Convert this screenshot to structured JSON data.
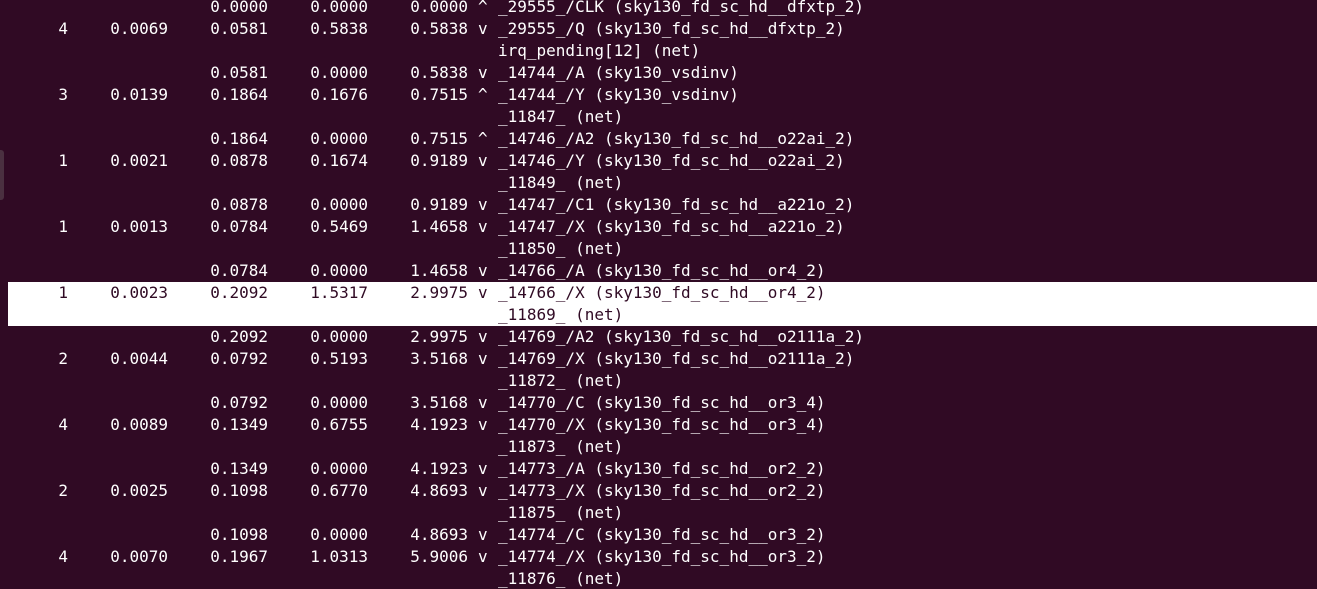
{
  "terminal": {
    "theme_colors": {
      "background": "#300a24",
      "foreground": "#ffffff",
      "selection": "#ffffff"
    },
    "rows": [
      {
        "fanout": "",
        "cap": "",
        "slew": "0.0000",
        "delay": "0.0000",
        "time": "0.0000",
        "dir": "^",
        "desc": "_29555_/CLK (sky130_fd_sc_hd__dfxtp_2)"
      },
      {
        "fanout": "4",
        "cap": "0.0069",
        "slew": "0.0581",
        "delay": "0.5838",
        "time": "0.5838",
        "dir": "v",
        "desc": "_29555_/Q (sky130_fd_sc_hd__dfxtp_2)"
      },
      {
        "fanout": "",
        "cap": "",
        "slew": "",
        "delay": "",
        "time": "",
        "dir": "",
        "desc": "irq_pending[12] (net)"
      },
      {
        "fanout": "",
        "cap": "",
        "slew": "0.0581",
        "delay": "0.0000",
        "time": "0.5838",
        "dir": "v",
        "desc": "_14744_/A (sky130_vsdinv)"
      },
      {
        "fanout": "3",
        "cap": "0.0139",
        "slew": "0.1864",
        "delay": "0.1676",
        "time": "0.7515",
        "dir": "^",
        "desc": "_14744_/Y (sky130_vsdinv)"
      },
      {
        "fanout": "",
        "cap": "",
        "slew": "",
        "delay": "",
        "time": "",
        "dir": "",
        "desc": "_11847_ (net)"
      },
      {
        "fanout": "",
        "cap": "",
        "slew": "0.1864",
        "delay": "0.0000",
        "time": "0.7515",
        "dir": "^",
        "desc": "_14746_/A2 (sky130_fd_sc_hd__o22ai_2)"
      },
      {
        "fanout": "1",
        "cap": "0.0021",
        "slew": "0.0878",
        "delay": "0.1674",
        "time": "0.9189",
        "dir": "v",
        "desc": "_14746_/Y (sky130_fd_sc_hd__o22ai_2)"
      },
      {
        "fanout": "",
        "cap": "",
        "slew": "",
        "delay": "",
        "time": "",
        "dir": "",
        "desc": "_11849_ (net)"
      },
      {
        "fanout": "",
        "cap": "",
        "slew": "0.0878",
        "delay": "0.0000",
        "time": "0.9189",
        "dir": "v",
        "desc": "_14747_/C1 (sky130_fd_sc_hd__a221o_2)"
      },
      {
        "fanout": "1",
        "cap": "0.0013",
        "slew": "0.0784",
        "delay": "0.5469",
        "time": "1.4658",
        "dir": "v",
        "desc": "_14747_/X (sky130_fd_sc_hd__a221o_2)"
      },
      {
        "fanout": "",
        "cap": "",
        "slew": "",
        "delay": "",
        "time": "",
        "dir": "",
        "desc": "_11850_ (net)"
      },
      {
        "fanout": "",
        "cap": "",
        "slew": "0.0784",
        "delay": "0.0000",
        "time": "1.4658",
        "dir": "v",
        "desc": "_14766_/A (sky130_fd_sc_hd__or4_2)"
      },
      {
        "fanout": "1",
        "cap": "0.0023",
        "slew": "0.2092",
        "delay": "1.5317",
        "time": "2.9975",
        "dir": "v",
        "desc": "_14766_/X (sky130_fd_sc_hd__or4_2)",
        "selected": true
      },
      {
        "fanout": "",
        "cap": "",
        "slew": "",
        "delay": "",
        "time": "",
        "dir": "",
        "desc": "_11869_ (net)",
        "selected": true
      },
      {
        "fanout": "",
        "cap": "",
        "slew": "0.2092",
        "delay": "0.0000",
        "time": "2.9975",
        "dir": "v",
        "desc": "_14769_/A2 (sky130_fd_sc_hd__o2111a_2)"
      },
      {
        "fanout": "2",
        "cap": "0.0044",
        "slew": "0.0792",
        "delay": "0.5193",
        "time": "3.5168",
        "dir": "v",
        "desc": "_14769_/X (sky130_fd_sc_hd__o2111a_2)"
      },
      {
        "fanout": "",
        "cap": "",
        "slew": "",
        "delay": "",
        "time": "",
        "dir": "",
        "desc": "_11872_ (net)"
      },
      {
        "fanout": "",
        "cap": "",
        "slew": "0.0792",
        "delay": "0.0000",
        "time": "3.5168",
        "dir": "v",
        "desc": "_14770_/C (sky130_fd_sc_hd__or3_4)"
      },
      {
        "fanout": "4",
        "cap": "0.0089",
        "slew": "0.1349",
        "delay": "0.6755",
        "time": "4.1923",
        "dir": "v",
        "desc": "_14770_/X (sky130_fd_sc_hd__or3_4)"
      },
      {
        "fanout": "",
        "cap": "",
        "slew": "",
        "delay": "",
        "time": "",
        "dir": "",
        "desc": "_11873_ (net)"
      },
      {
        "fanout": "",
        "cap": "",
        "slew": "0.1349",
        "delay": "0.0000",
        "time": "4.1923",
        "dir": "v",
        "desc": "_14773_/A (sky130_fd_sc_hd__or2_2)"
      },
      {
        "fanout": "2",
        "cap": "0.0025",
        "slew": "0.1098",
        "delay": "0.6770",
        "time": "4.8693",
        "dir": "v",
        "desc": "_14773_/X (sky130_fd_sc_hd__or2_2)"
      },
      {
        "fanout": "",
        "cap": "",
        "slew": "",
        "delay": "",
        "time": "",
        "dir": "",
        "desc": "_11875_ (net)"
      },
      {
        "fanout": "",
        "cap": "",
        "slew": "0.1098",
        "delay": "0.0000",
        "time": "4.8693",
        "dir": "v",
        "desc": "_14774_/C (sky130_fd_sc_hd__or3_2)"
      },
      {
        "fanout": "4",
        "cap": "0.0070",
        "slew": "0.1967",
        "delay": "1.0313",
        "time": "5.9006",
        "dir": "v",
        "desc": "_14774_/X (sky130_fd_sc_hd__or3_2)"
      },
      {
        "fanout": "",
        "cap": "",
        "slew": "",
        "delay": "",
        "time": "",
        "dir": "",
        "desc": "_11876_ (net)"
      }
    ]
  }
}
